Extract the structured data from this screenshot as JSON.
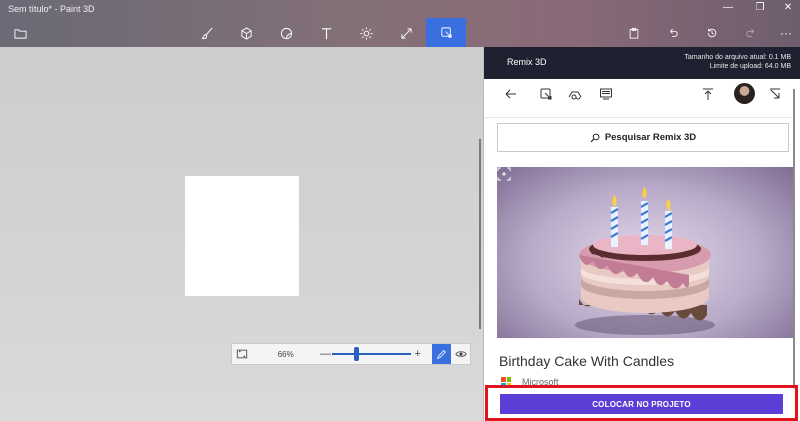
{
  "window": {
    "title": "Sem título* - Paint 3D",
    "controls": {
      "minimize": "—",
      "maximize": "❐",
      "close": "✕"
    }
  },
  "toolbar": {
    "tools": [
      {
        "name": "brushes",
        "icon": "brush-icon"
      },
      {
        "name": "3d-shapes",
        "icon": "cube-icon"
      },
      {
        "name": "stickers",
        "icon": "sticker-icon"
      },
      {
        "name": "text",
        "icon": "text-icon"
      },
      {
        "name": "effects",
        "icon": "sun-icon"
      },
      {
        "name": "canvas",
        "icon": "resize-icon"
      },
      {
        "name": "remix-3d",
        "icon": "remix-icon",
        "active": true
      }
    ],
    "right": [
      {
        "name": "paste",
        "icon": "paste-icon"
      },
      {
        "name": "undo",
        "icon": "undo-icon"
      },
      {
        "name": "history",
        "icon": "history-icon"
      },
      {
        "name": "redo",
        "icon": "redo-icon"
      },
      {
        "name": "more",
        "icon": "more-icon",
        "glyph": "···"
      }
    ],
    "accent": "#3a6fe0"
  },
  "zoom": {
    "percent": "66%",
    "minus": "—",
    "plus": "+",
    "level": 0.3
  },
  "panel": {
    "title": "Remix 3D",
    "file_size": "Tamanho do arquivo atual: 0.1 MB",
    "upload_limit": "Limite de upload: 64.0 MB",
    "search_label": "Pesquisar Remix 3D",
    "model_title": "Birthday Cake With Candles",
    "publisher": "Microsoft",
    "cta_label": "COLOCAR NO PROJETO",
    "cta_color": "#5b3ed6",
    "highlight_color": "#e0141e"
  }
}
